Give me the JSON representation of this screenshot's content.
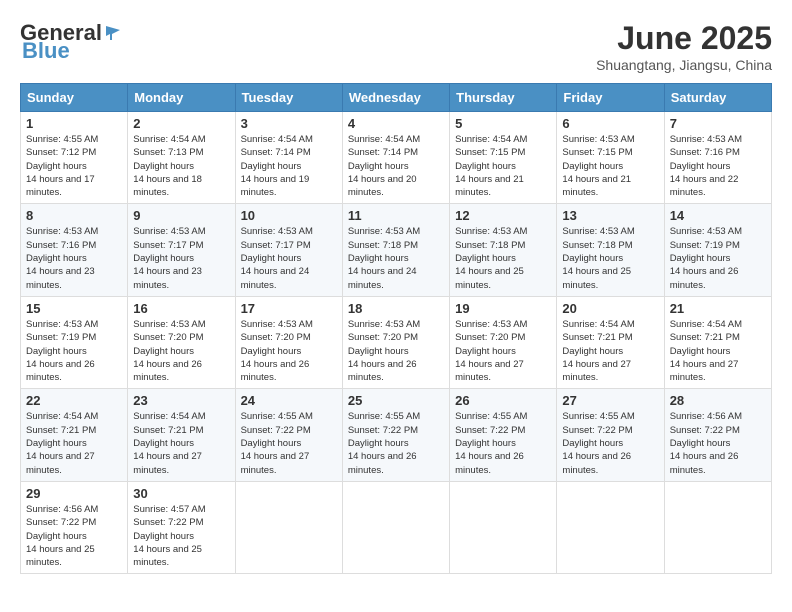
{
  "header": {
    "logo_general": "General",
    "logo_blue": "Blue",
    "month": "June 2025",
    "location": "Shuangtang, Jiangsu, China"
  },
  "weekdays": [
    "Sunday",
    "Monday",
    "Tuesday",
    "Wednesday",
    "Thursday",
    "Friday",
    "Saturday"
  ],
  "weeks": [
    [
      {
        "day": "1",
        "sunrise": "4:55 AM",
        "sunset": "7:12 PM",
        "daylight": "14 hours and 17 minutes."
      },
      {
        "day": "2",
        "sunrise": "4:54 AM",
        "sunset": "7:13 PM",
        "daylight": "14 hours and 18 minutes."
      },
      {
        "day": "3",
        "sunrise": "4:54 AM",
        "sunset": "7:14 PM",
        "daylight": "14 hours and 19 minutes."
      },
      {
        "day": "4",
        "sunrise": "4:54 AM",
        "sunset": "7:14 PM",
        "daylight": "14 hours and 20 minutes."
      },
      {
        "day": "5",
        "sunrise": "4:54 AM",
        "sunset": "7:15 PM",
        "daylight": "14 hours and 21 minutes."
      },
      {
        "day": "6",
        "sunrise": "4:53 AM",
        "sunset": "7:15 PM",
        "daylight": "14 hours and 21 minutes."
      },
      {
        "day": "7",
        "sunrise": "4:53 AM",
        "sunset": "7:16 PM",
        "daylight": "14 hours and 22 minutes."
      }
    ],
    [
      {
        "day": "8",
        "sunrise": "4:53 AM",
        "sunset": "7:16 PM",
        "daylight": "14 hours and 23 minutes."
      },
      {
        "day": "9",
        "sunrise": "4:53 AM",
        "sunset": "7:17 PM",
        "daylight": "14 hours and 23 minutes."
      },
      {
        "day": "10",
        "sunrise": "4:53 AM",
        "sunset": "7:17 PM",
        "daylight": "14 hours and 24 minutes."
      },
      {
        "day": "11",
        "sunrise": "4:53 AM",
        "sunset": "7:18 PM",
        "daylight": "14 hours and 24 minutes."
      },
      {
        "day": "12",
        "sunrise": "4:53 AM",
        "sunset": "7:18 PM",
        "daylight": "14 hours and 25 minutes."
      },
      {
        "day": "13",
        "sunrise": "4:53 AM",
        "sunset": "7:18 PM",
        "daylight": "14 hours and 25 minutes."
      },
      {
        "day": "14",
        "sunrise": "4:53 AM",
        "sunset": "7:19 PM",
        "daylight": "14 hours and 26 minutes."
      }
    ],
    [
      {
        "day": "15",
        "sunrise": "4:53 AM",
        "sunset": "7:19 PM",
        "daylight": "14 hours and 26 minutes."
      },
      {
        "day": "16",
        "sunrise": "4:53 AM",
        "sunset": "7:20 PM",
        "daylight": "14 hours and 26 minutes."
      },
      {
        "day": "17",
        "sunrise": "4:53 AM",
        "sunset": "7:20 PM",
        "daylight": "14 hours and 26 minutes."
      },
      {
        "day": "18",
        "sunrise": "4:53 AM",
        "sunset": "7:20 PM",
        "daylight": "14 hours and 26 minutes."
      },
      {
        "day": "19",
        "sunrise": "4:53 AM",
        "sunset": "7:20 PM",
        "daylight": "14 hours and 27 minutes."
      },
      {
        "day": "20",
        "sunrise": "4:54 AM",
        "sunset": "7:21 PM",
        "daylight": "14 hours and 27 minutes."
      },
      {
        "day": "21",
        "sunrise": "4:54 AM",
        "sunset": "7:21 PM",
        "daylight": "14 hours and 27 minutes."
      }
    ],
    [
      {
        "day": "22",
        "sunrise": "4:54 AM",
        "sunset": "7:21 PM",
        "daylight": "14 hours and 27 minutes."
      },
      {
        "day": "23",
        "sunrise": "4:54 AM",
        "sunset": "7:21 PM",
        "daylight": "14 hours and 27 minutes."
      },
      {
        "day": "24",
        "sunrise": "4:55 AM",
        "sunset": "7:22 PM",
        "daylight": "14 hours and 27 minutes."
      },
      {
        "day": "25",
        "sunrise": "4:55 AM",
        "sunset": "7:22 PM",
        "daylight": "14 hours and 26 minutes."
      },
      {
        "day": "26",
        "sunrise": "4:55 AM",
        "sunset": "7:22 PM",
        "daylight": "14 hours and 26 minutes."
      },
      {
        "day": "27",
        "sunrise": "4:55 AM",
        "sunset": "7:22 PM",
        "daylight": "14 hours and 26 minutes."
      },
      {
        "day": "28",
        "sunrise": "4:56 AM",
        "sunset": "7:22 PM",
        "daylight": "14 hours and 26 minutes."
      }
    ],
    [
      {
        "day": "29",
        "sunrise": "4:56 AM",
        "sunset": "7:22 PM",
        "daylight": "14 hours and 25 minutes."
      },
      {
        "day": "30",
        "sunrise": "4:57 AM",
        "sunset": "7:22 PM",
        "daylight": "14 hours and 25 minutes."
      },
      null,
      null,
      null,
      null,
      null
    ]
  ]
}
